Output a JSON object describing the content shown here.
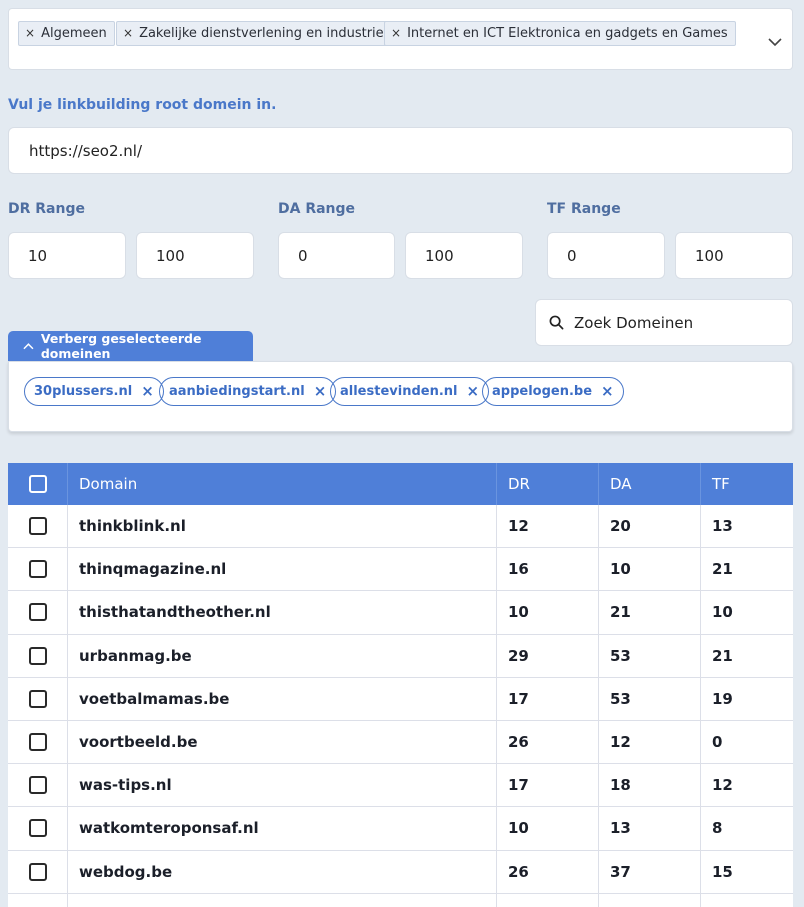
{
  "categories": {
    "tags": [
      "Algemeen",
      "Zakelijke dienstverlening en industrie",
      "Internet en ICT Elektronica en gadgets en Games"
    ],
    "remove_symbol": "×"
  },
  "domain_input": {
    "label": "Vul je linkbuilding root domein in.",
    "value": "https://seo2.nl/"
  },
  "ranges": {
    "dr": {
      "label": "DR Range",
      "min": "10",
      "max": "100"
    },
    "da": {
      "label": "DA Range",
      "min": "0",
      "max": "100"
    },
    "tf": {
      "label": "TF Range",
      "min": "0",
      "max": "100"
    }
  },
  "search": {
    "placeholder": "Zoek Domeinen"
  },
  "selected": {
    "toggle_label": "Verberg geselecteerde domeinen",
    "chips": [
      "30plussers.nl",
      "aanbiedingstart.nl",
      "allestevinden.nl",
      "appelogen.be"
    ],
    "remove_symbol": "×"
  },
  "table": {
    "headers": {
      "domain": "Domain",
      "dr": "DR",
      "da": "DA",
      "tf": "TF"
    },
    "rows": [
      {
        "domain": "thinkblink.nl",
        "dr": "12",
        "da": "20",
        "tf": "13"
      },
      {
        "domain": "thinqmagazine.nl",
        "dr": "16",
        "da": "10",
        "tf": "21"
      },
      {
        "domain": "thisthatandtheother.nl",
        "dr": "10",
        "da": "21",
        "tf": "10"
      },
      {
        "domain": "urbanmag.be",
        "dr": "29",
        "da": "53",
        "tf": "21"
      },
      {
        "domain": "voetbalmamas.be",
        "dr": "17",
        "da": "53",
        "tf": "19"
      },
      {
        "domain": "voortbeeld.be",
        "dr": "26",
        "da": "12",
        "tf": "0"
      },
      {
        "domain": "was-tips.nl",
        "dr": "17",
        "da": "18",
        "tf": "12"
      },
      {
        "domain": "watkomteroponsaf.nl",
        "dr": "10",
        "da": "13",
        "tf": "8"
      },
      {
        "domain": "webdog.be",
        "dr": "26",
        "da": "37",
        "tf": "15"
      },
      {
        "domain": "",
        "dr": "",
        "da": "",
        "tf": ""
      }
    ]
  },
  "colors": {
    "accent": "#4f7fd8",
    "label_blue": "#4a78c9",
    "background": "#e3eaf1"
  }
}
